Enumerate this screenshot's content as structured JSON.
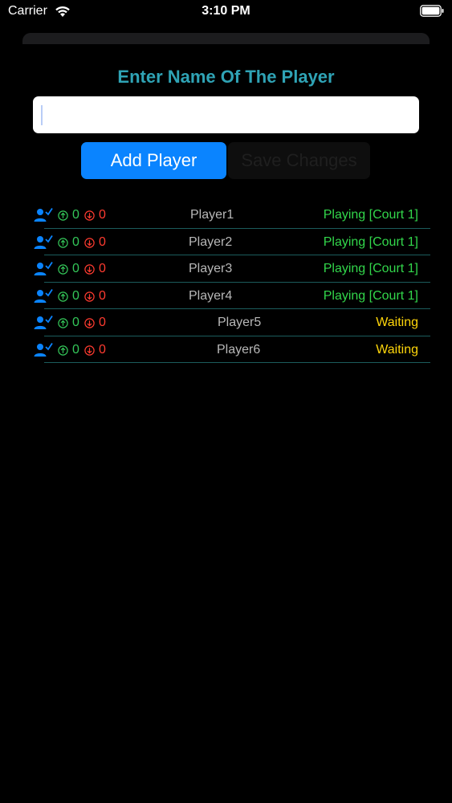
{
  "status_bar": {
    "carrier": "Carrier",
    "time": "3:10 PM",
    "wifi_icon": "wifi-icon",
    "battery_icon": "battery-icon"
  },
  "form": {
    "heading": "Enter Name Of The Player",
    "input_value": "",
    "input_placeholder": "",
    "add_button": "Add Player",
    "save_button": "Save Changes"
  },
  "colors": {
    "heading": "#2fa3b5",
    "accent_blue": "#0a84ff",
    "win_green": "#34c759",
    "loss_red": "#ff3b30",
    "playing_green": "#32d74b",
    "waiting_yellow": "#ffd60a",
    "divider": "#1b5c5c"
  },
  "players": [
    {
      "name": "Player1",
      "wins": "0",
      "losses": "0",
      "status": "Playing [Court 1]",
      "state": "playing"
    },
    {
      "name": "Player2",
      "wins": "0",
      "losses": "0",
      "status": "Playing [Court 1]",
      "state": "playing"
    },
    {
      "name": "Player3",
      "wins": "0",
      "losses": "0",
      "status": "Playing [Court 1]",
      "state": "playing"
    },
    {
      "name": "Player4",
      "wins": "0",
      "losses": "0",
      "status": "Playing [Court 1]",
      "state": "playing"
    },
    {
      "name": "Player5",
      "wins": "0",
      "losses": "0",
      "status": "Waiting",
      "state": "waiting"
    },
    {
      "name": "Player6",
      "wins": "0",
      "losses": "0",
      "status": "Waiting",
      "state": "waiting"
    }
  ]
}
